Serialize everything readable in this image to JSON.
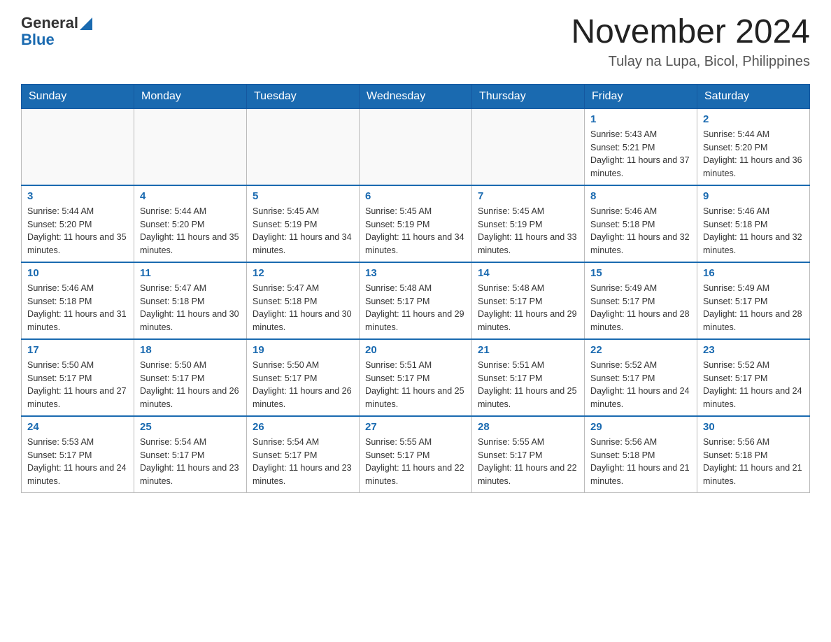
{
  "header": {
    "logo_general": "General",
    "logo_blue": "Blue",
    "month_title": "November 2024",
    "subtitle": "Tulay na Lupa, Bicol, Philippines"
  },
  "days_of_week": [
    "Sunday",
    "Monday",
    "Tuesday",
    "Wednesday",
    "Thursday",
    "Friday",
    "Saturday"
  ],
  "weeks": [
    [
      {
        "day": "",
        "sunrise": "",
        "sunset": "",
        "daylight": ""
      },
      {
        "day": "",
        "sunrise": "",
        "sunset": "",
        "daylight": ""
      },
      {
        "day": "",
        "sunrise": "",
        "sunset": "",
        "daylight": ""
      },
      {
        "day": "",
        "sunrise": "",
        "sunset": "",
        "daylight": ""
      },
      {
        "day": "",
        "sunrise": "",
        "sunset": "",
        "daylight": ""
      },
      {
        "day": "1",
        "sunrise": "Sunrise: 5:43 AM",
        "sunset": "Sunset: 5:21 PM",
        "daylight": "Daylight: 11 hours and 37 minutes."
      },
      {
        "day": "2",
        "sunrise": "Sunrise: 5:44 AM",
        "sunset": "Sunset: 5:20 PM",
        "daylight": "Daylight: 11 hours and 36 minutes."
      }
    ],
    [
      {
        "day": "3",
        "sunrise": "Sunrise: 5:44 AM",
        "sunset": "Sunset: 5:20 PM",
        "daylight": "Daylight: 11 hours and 35 minutes."
      },
      {
        "day": "4",
        "sunrise": "Sunrise: 5:44 AM",
        "sunset": "Sunset: 5:20 PM",
        "daylight": "Daylight: 11 hours and 35 minutes."
      },
      {
        "day": "5",
        "sunrise": "Sunrise: 5:45 AM",
        "sunset": "Sunset: 5:19 PM",
        "daylight": "Daylight: 11 hours and 34 minutes."
      },
      {
        "day": "6",
        "sunrise": "Sunrise: 5:45 AM",
        "sunset": "Sunset: 5:19 PM",
        "daylight": "Daylight: 11 hours and 34 minutes."
      },
      {
        "day": "7",
        "sunrise": "Sunrise: 5:45 AM",
        "sunset": "Sunset: 5:19 PM",
        "daylight": "Daylight: 11 hours and 33 minutes."
      },
      {
        "day": "8",
        "sunrise": "Sunrise: 5:46 AM",
        "sunset": "Sunset: 5:18 PM",
        "daylight": "Daylight: 11 hours and 32 minutes."
      },
      {
        "day": "9",
        "sunrise": "Sunrise: 5:46 AM",
        "sunset": "Sunset: 5:18 PM",
        "daylight": "Daylight: 11 hours and 32 minutes."
      }
    ],
    [
      {
        "day": "10",
        "sunrise": "Sunrise: 5:46 AM",
        "sunset": "Sunset: 5:18 PM",
        "daylight": "Daylight: 11 hours and 31 minutes."
      },
      {
        "day": "11",
        "sunrise": "Sunrise: 5:47 AM",
        "sunset": "Sunset: 5:18 PM",
        "daylight": "Daylight: 11 hours and 30 minutes."
      },
      {
        "day": "12",
        "sunrise": "Sunrise: 5:47 AM",
        "sunset": "Sunset: 5:18 PM",
        "daylight": "Daylight: 11 hours and 30 minutes."
      },
      {
        "day": "13",
        "sunrise": "Sunrise: 5:48 AM",
        "sunset": "Sunset: 5:17 PM",
        "daylight": "Daylight: 11 hours and 29 minutes."
      },
      {
        "day": "14",
        "sunrise": "Sunrise: 5:48 AM",
        "sunset": "Sunset: 5:17 PM",
        "daylight": "Daylight: 11 hours and 29 minutes."
      },
      {
        "day": "15",
        "sunrise": "Sunrise: 5:49 AM",
        "sunset": "Sunset: 5:17 PM",
        "daylight": "Daylight: 11 hours and 28 minutes."
      },
      {
        "day": "16",
        "sunrise": "Sunrise: 5:49 AM",
        "sunset": "Sunset: 5:17 PM",
        "daylight": "Daylight: 11 hours and 28 minutes."
      }
    ],
    [
      {
        "day": "17",
        "sunrise": "Sunrise: 5:50 AM",
        "sunset": "Sunset: 5:17 PM",
        "daylight": "Daylight: 11 hours and 27 minutes."
      },
      {
        "day": "18",
        "sunrise": "Sunrise: 5:50 AM",
        "sunset": "Sunset: 5:17 PM",
        "daylight": "Daylight: 11 hours and 26 minutes."
      },
      {
        "day": "19",
        "sunrise": "Sunrise: 5:50 AM",
        "sunset": "Sunset: 5:17 PM",
        "daylight": "Daylight: 11 hours and 26 minutes."
      },
      {
        "day": "20",
        "sunrise": "Sunrise: 5:51 AM",
        "sunset": "Sunset: 5:17 PM",
        "daylight": "Daylight: 11 hours and 25 minutes."
      },
      {
        "day": "21",
        "sunrise": "Sunrise: 5:51 AM",
        "sunset": "Sunset: 5:17 PM",
        "daylight": "Daylight: 11 hours and 25 minutes."
      },
      {
        "day": "22",
        "sunrise": "Sunrise: 5:52 AM",
        "sunset": "Sunset: 5:17 PM",
        "daylight": "Daylight: 11 hours and 24 minutes."
      },
      {
        "day": "23",
        "sunrise": "Sunrise: 5:52 AM",
        "sunset": "Sunset: 5:17 PM",
        "daylight": "Daylight: 11 hours and 24 minutes."
      }
    ],
    [
      {
        "day": "24",
        "sunrise": "Sunrise: 5:53 AM",
        "sunset": "Sunset: 5:17 PM",
        "daylight": "Daylight: 11 hours and 24 minutes."
      },
      {
        "day": "25",
        "sunrise": "Sunrise: 5:54 AM",
        "sunset": "Sunset: 5:17 PM",
        "daylight": "Daylight: 11 hours and 23 minutes."
      },
      {
        "day": "26",
        "sunrise": "Sunrise: 5:54 AM",
        "sunset": "Sunset: 5:17 PM",
        "daylight": "Daylight: 11 hours and 23 minutes."
      },
      {
        "day": "27",
        "sunrise": "Sunrise: 5:55 AM",
        "sunset": "Sunset: 5:17 PM",
        "daylight": "Daylight: 11 hours and 22 minutes."
      },
      {
        "day": "28",
        "sunrise": "Sunrise: 5:55 AM",
        "sunset": "Sunset: 5:17 PM",
        "daylight": "Daylight: 11 hours and 22 minutes."
      },
      {
        "day": "29",
        "sunrise": "Sunrise: 5:56 AM",
        "sunset": "Sunset: 5:18 PM",
        "daylight": "Daylight: 11 hours and 21 minutes."
      },
      {
        "day": "30",
        "sunrise": "Sunrise: 5:56 AM",
        "sunset": "Sunset: 5:18 PM",
        "daylight": "Daylight: 11 hours and 21 minutes."
      }
    ]
  ]
}
